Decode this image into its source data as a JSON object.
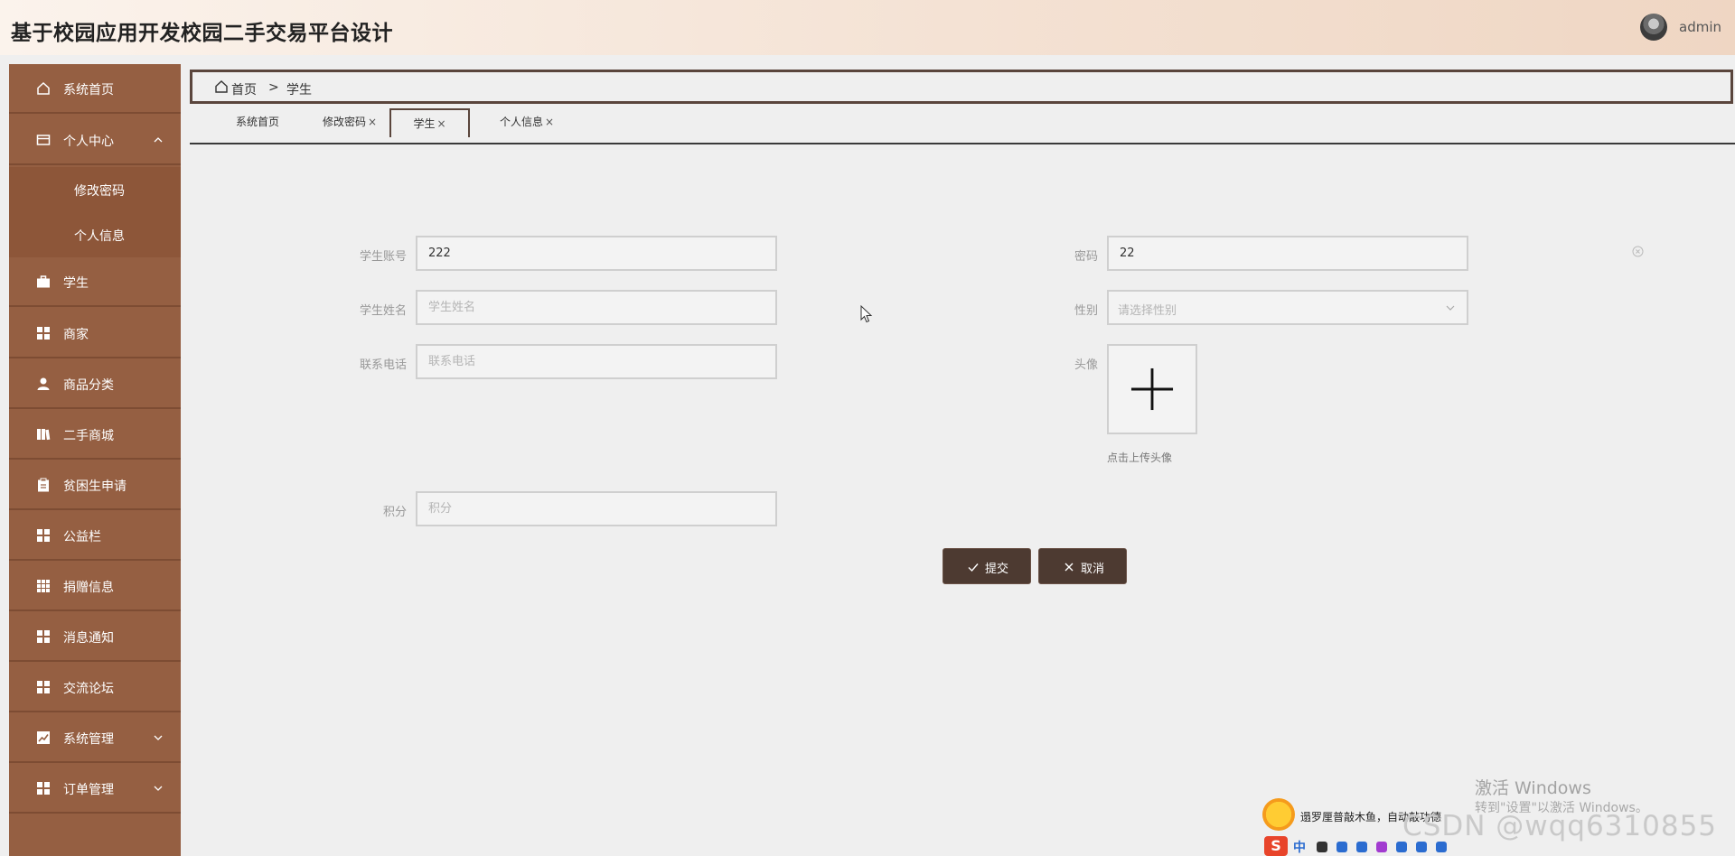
{
  "app": {
    "title": "基于校园应用开发校园二手交易平台设计",
    "username": "admin"
  },
  "sidebar": {
    "items": [
      {
        "label": "系统首页",
        "icon": "home-icon"
      },
      {
        "label": "个人中心",
        "icon": "wallet-icon",
        "expanded": true
      },
      {
        "label": "修改密码",
        "sub": true
      },
      {
        "label": "个人信息",
        "sub": true
      },
      {
        "label": "学生",
        "icon": "briefcase-icon"
      },
      {
        "label": "商家",
        "icon": "grid-icon"
      },
      {
        "label": "商品分类",
        "icon": "user-icon"
      },
      {
        "label": "二手商城",
        "icon": "book-icon"
      },
      {
        "label": "贫困生申请",
        "icon": "clipboard-icon"
      },
      {
        "label": "公益栏",
        "icon": "grid-icon"
      },
      {
        "label": "捐赠信息",
        "icon": "table-icon"
      },
      {
        "label": "消息通知",
        "icon": "grid-icon"
      },
      {
        "label": "交流论坛",
        "icon": "grid-icon"
      },
      {
        "label": "系统管理",
        "icon": "chart-icon",
        "collapsible": true
      },
      {
        "label": "订单管理",
        "icon": "grid-icon",
        "collapsible": true
      }
    ]
  },
  "breadcrumb": {
    "home": "首页",
    "separator": ">",
    "current": "学生"
  },
  "tabs": [
    {
      "label": "系统首页",
      "closable": false
    },
    {
      "label": "修改密码",
      "closable": true
    },
    {
      "label": "学生",
      "closable": true,
      "active": true
    },
    {
      "label": "个人信息",
      "closable": true
    }
  ],
  "tab_close_glyph": "×",
  "form": {
    "account": {
      "label": "学生账号",
      "value": "222"
    },
    "password": {
      "label": "密码",
      "value": "22"
    },
    "name": {
      "label": "学生姓名",
      "placeholder": "学生姓名"
    },
    "gender": {
      "label": "性别",
      "placeholder": "请选择性别"
    },
    "phone": {
      "label": "联系电话",
      "placeholder": "联系电话"
    },
    "avatar": {
      "label": "头像",
      "hint": "点击上传头像"
    },
    "points": {
      "label": "积分",
      "placeholder": "积分"
    }
  },
  "buttons": {
    "submit": "提交",
    "cancel": "取消"
  },
  "overlays": {
    "win_line1": "激活 Windows",
    "win_line2": "转到\"设置\"以激活 Windows。",
    "csdn": "CSDN @wqq6310855",
    "ime_message": "遢罗厘普敲木鱼，自动敲功德",
    "ime_logo": "S",
    "ime_mode": "中"
  },
  "colors": {
    "sidebar": "#955f42",
    "button": "#4d3a31",
    "border_accent": "#5a453c"
  }
}
